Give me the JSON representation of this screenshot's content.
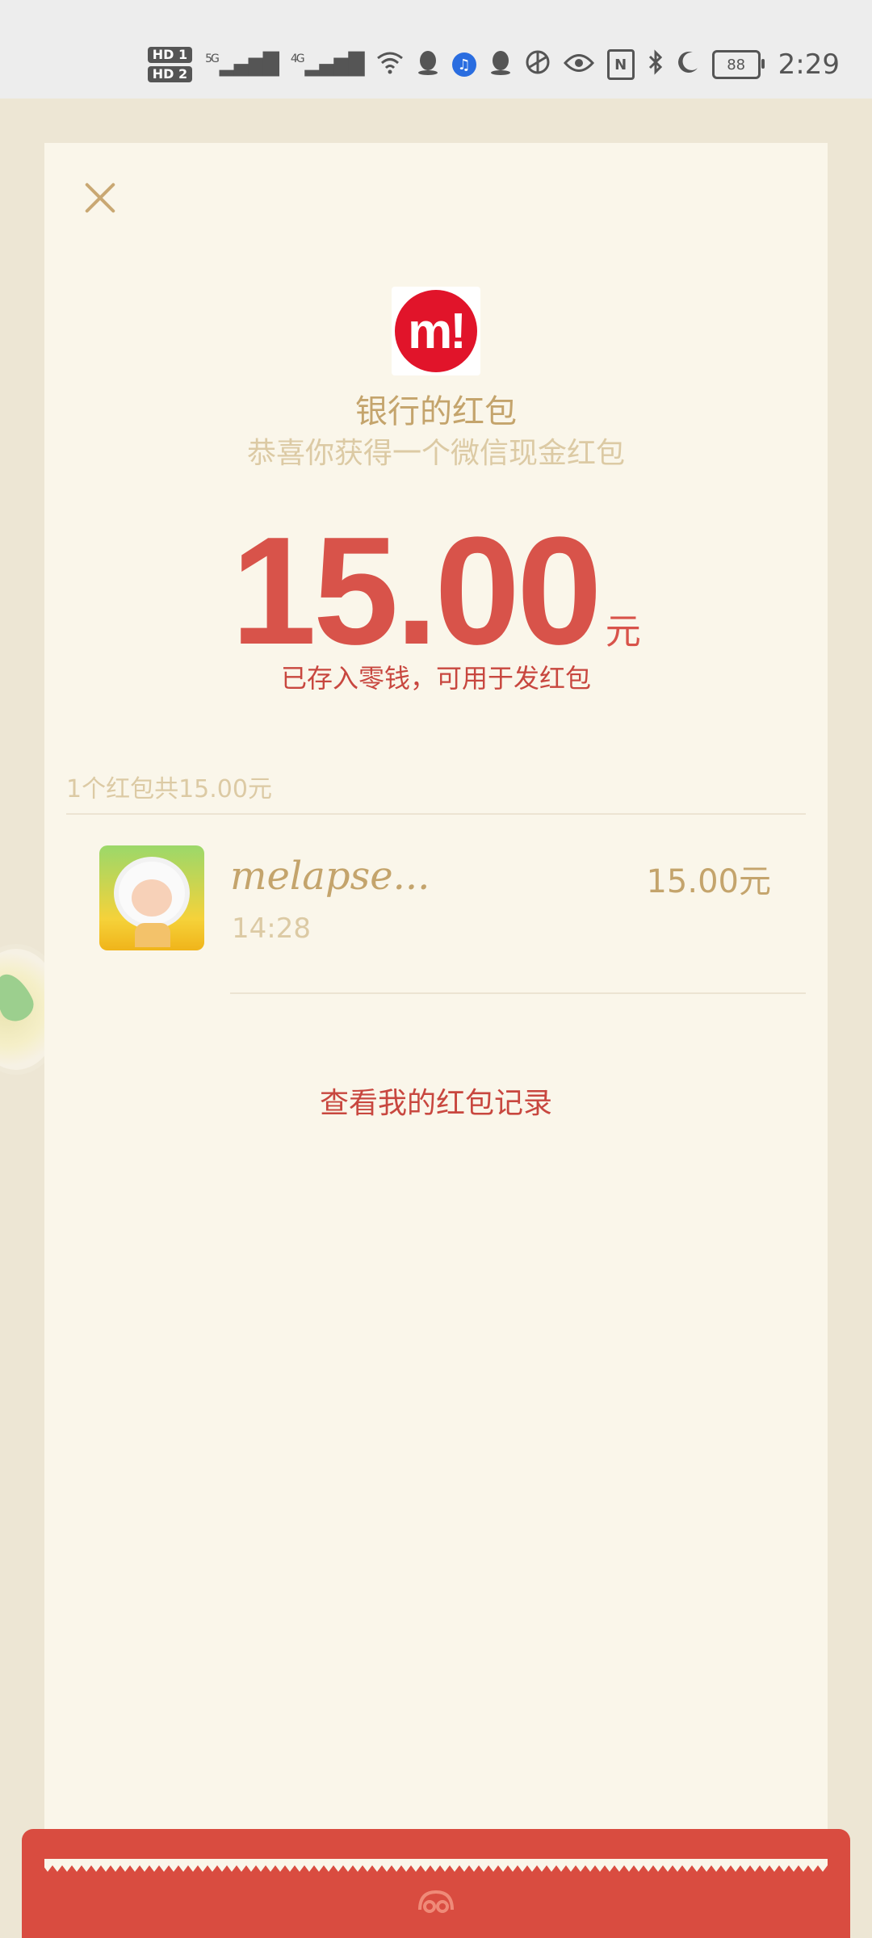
{
  "status_bar": {
    "hd1": "HD 1",
    "hd2": "HD 2",
    "net1": "5G",
    "net2": "4G",
    "battery": "88",
    "time": "2:29",
    "icons": [
      "wifi-icon",
      "qq-icon",
      "music-icon",
      "qq-icon",
      "browser-icon",
      "eye-icon",
      "nfc-icon",
      "bluetooth-icon",
      "moon-icon"
    ]
  },
  "red_packet": {
    "sender_title": "银行的红包",
    "sender_subtitle": "恭喜你获得一个微信现金红包",
    "amount": "15.00",
    "amount_unit": "元",
    "saved_note": "已存入零钱，可用于发红包",
    "summary": "1个红包共15.00元",
    "records": [
      {
        "name": "melapse...",
        "time": "14:28",
        "amount": "15.00元"
      }
    ],
    "history_link": "查看我的红包记录"
  },
  "colors": {
    "gold": "#c4a46c",
    "red": "#d8534a",
    "card_bg": "#faf6ea",
    "envelope_red": "#d94c40"
  }
}
